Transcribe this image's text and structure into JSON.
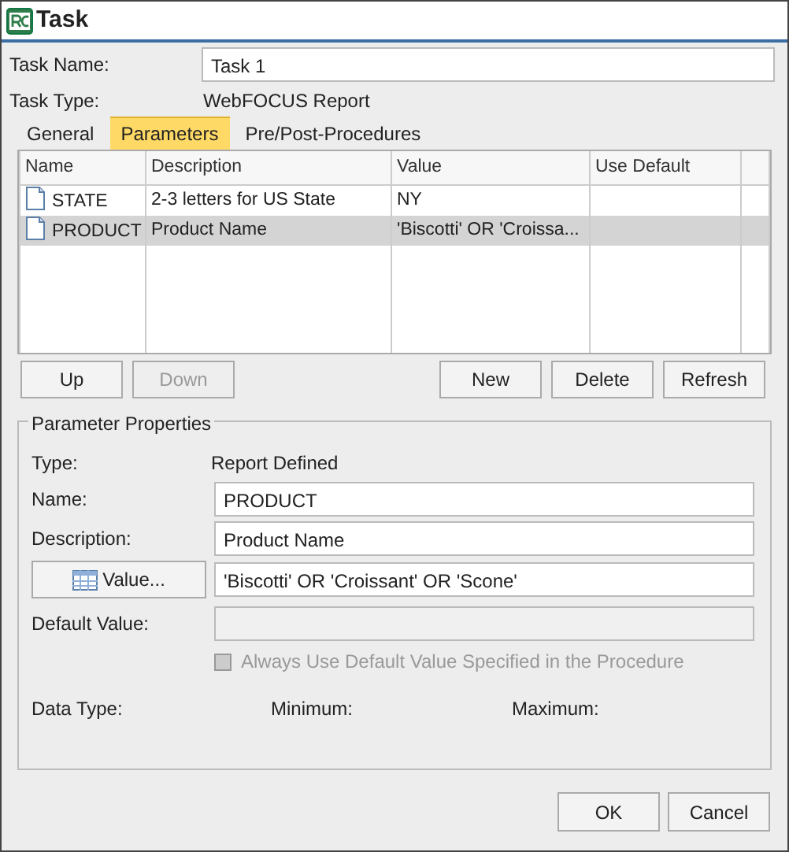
{
  "window": {
    "title": "Task"
  },
  "task_name": {
    "label": "Task Name:",
    "value": "Task 1"
  },
  "task_type": {
    "label": "Task Type:",
    "value": "WebFOCUS Report"
  },
  "tabs": [
    {
      "label": "General",
      "selected": false
    },
    {
      "label": "Parameters",
      "selected": true
    },
    {
      "label": "Pre/Post-Procedures",
      "selected": false
    }
  ],
  "parameters_table": {
    "columns": [
      "Name",
      "Description",
      "Value",
      "Use Default"
    ],
    "rows": [
      {
        "name": "STATE",
        "description": "2-3 letters for US State",
        "value": "NY",
        "selected": false
      },
      {
        "name": "PRODUCT",
        "description": "Product Name",
        "value": "'Biscotti' OR 'Croissa...",
        "selected": true
      }
    ]
  },
  "list_buttons_left": [
    {
      "label": "Up",
      "disabled": false
    },
    {
      "label": "Down",
      "disabled": true
    }
  ],
  "list_buttons_right": [
    {
      "label": "New",
      "disabled": false
    },
    {
      "label": "Delete",
      "disabled": false
    },
    {
      "label": "Refresh",
      "disabled": false
    }
  ],
  "properties": {
    "title": "Parameter Properties",
    "type": {
      "label": "Type:",
      "value": "Report Defined"
    },
    "name": {
      "label": "Name:",
      "value": "PRODUCT"
    },
    "description": {
      "label": "Description:",
      "value": "Product Name"
    },
    "value": {
      "button": "Value...",
      "value": "'Biscotti' OR 'Croissant' OR 'Scone'"
    },
    "default_value": {
      "label": "Default Value:",
      "disabled": true
    },
    "always_use_default": {
      "label": "Always Use Default Value Specified in the Procedure",
      "checked": false,
      "disabled": true
    },
    "data_type": {
      "label": "Data Type:"
    },
    "minimum": {
      "label": "Minimum:"
    },
    "maximum": {
      "label": "Maximum:"
    }
  },
  "dialog_buttons": [
    {
      "label": "OK"
    },
    {
      "label": "Cancel"
    }
  ]
}
